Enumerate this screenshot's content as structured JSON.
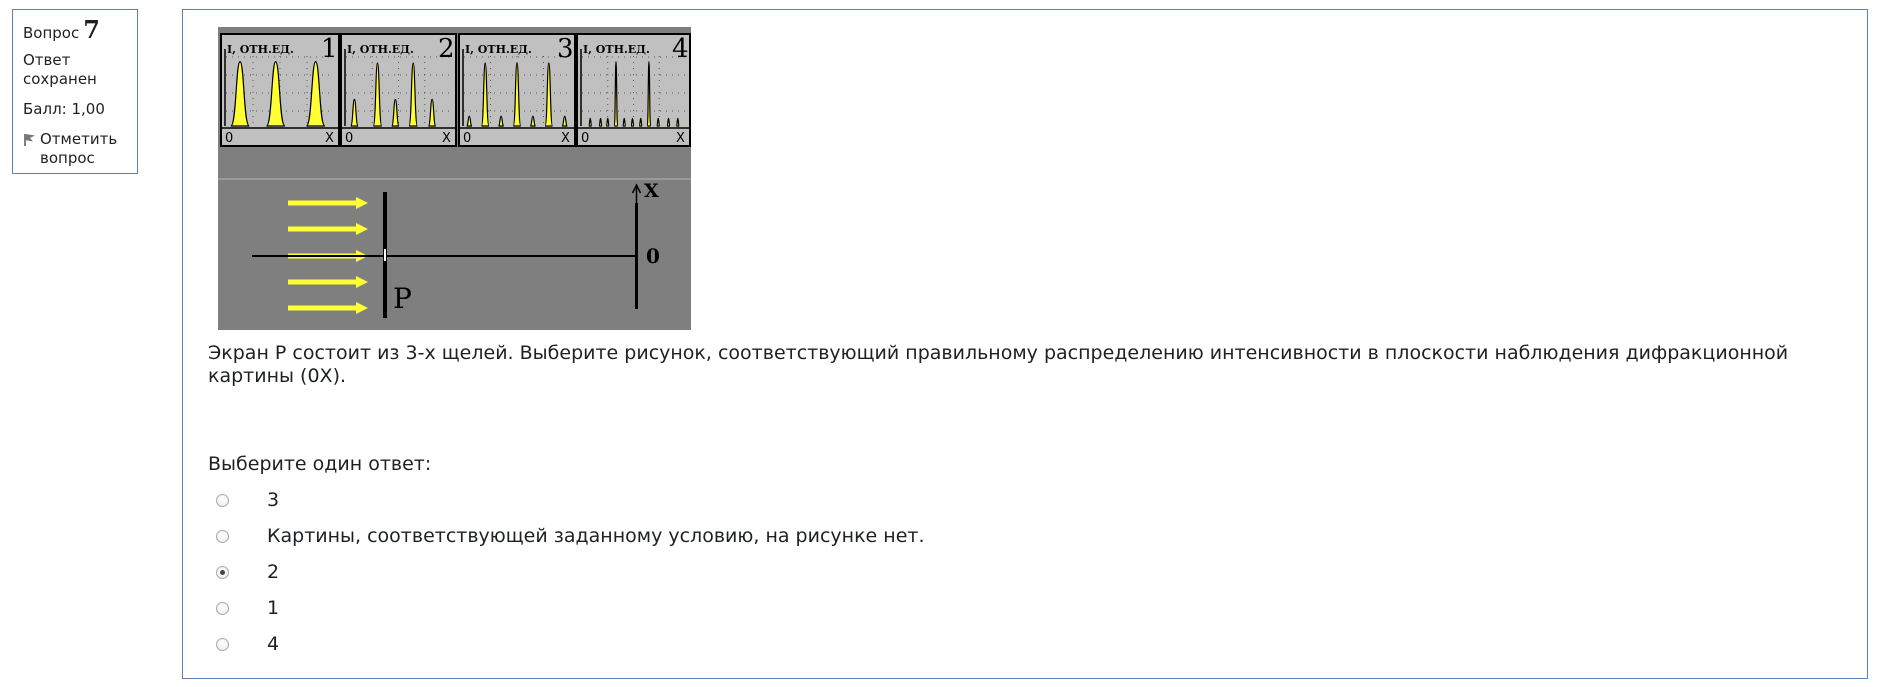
{
  "question_info": {
    "label": "Вопрос",
    "number": "7",
    "state": "Ответ сохранен",
    "grade": "Балл: 1,00",
    "flag_label": "Отметить вопрос"
  },
  "figure": {
    "panels": [
      {
        "label": "I, отн.ед.",
        "number": "1",
        "axis_origin": "0",
        "axis_x": "X"
      },
      {
        "label": "I, отн.ед.",
        "number": "2",
        "axis_origin": "0",
        "axis_x": "X"
      },
      {
        "label": "I, отн.ед.",
        "number": "3",
        "axis_origin": "0",
        "axis_x": "X"
      },
      {
        "label": "I, отн.ед.",
        "number": "4",
        "axis_origin": "0",
        "axis_x": "X"
      }
    ],
    "setup": {
      "screen_label": "P",
      "axis_label": "X",
      "origin_label": "0"
    },
    "colors": {
      "background": "#7f7f7f",
      "panel": "#c0c0c0",
      "peak": "#ffff33",
      "frame": "#000000"
    }
  },
  "question_text": "Экран Р состоит из 3-х щелей. Выберите рисунок, соответствующий правильному распределению интенсивности в плоскости наблюдения дифракционной картины (0X).",
  "prompt": "Выберите один ответ:",
  "answers": [
    {
      "label": "3",
      "checked": false
    },
    {
      "label": "Картины, соответствующей заданному условию, на рисунке нет.",
      "checked": false
    },
    {
      "label": "2",
      "checked": true
    },
    {
      "label": "1",
      "checked": false
    },
    {
      "label": "4",
      "checked": false
    }
  ]
}
